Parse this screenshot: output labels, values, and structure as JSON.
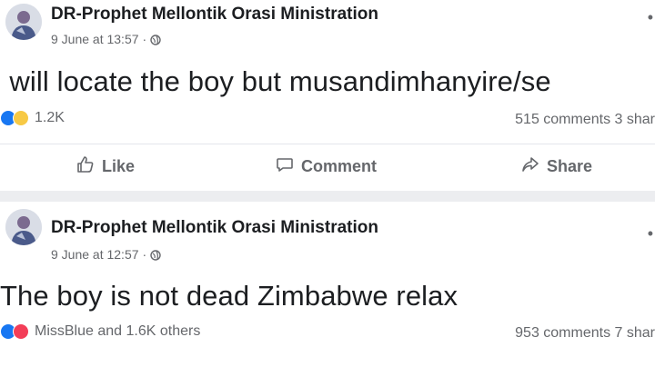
{
  "posts": [
    {
      "author": "DR-Prophet Mellontik Orasi Ministration",
      "timestamp": "9 June at 13:57",
      "separator": "·",
      "text": "I will locate the boy but musandimhanyire/se",
      "reaction_icons": [
        "like",
        "haha"
      ],
      "reactions_text": "1.2K",
      "comments_shares_text": "515 comments 3 shar",
      "actions": {
        "like": "Like",
        "comment": "Comment",
        "share": "Share"
      }
    },
    {
      "author": "DR-Prophet Mellontik Orasi Ministration",
      "timestamp": "9 June at 12:57",
      "separator": "·",
      "text": "The boy is not dead Zimbabwe relax",
      "reaction_icons": [
        "like",
        "love"
      ],
      "reactions_text": "MissBlue and 1.6K others",
      "comments_shares_text": "953 comments 7 shar"
    }
  ],
  "colors": {
    "like": "#1877f2",
    "haha": "#f7c945",
    "love": "#f33e58",
    "muted_text": "#65676b"
  },
  "icons": {
    "privacy": "globe-icon",
    "menu": "more-options-icon"
  }
}
